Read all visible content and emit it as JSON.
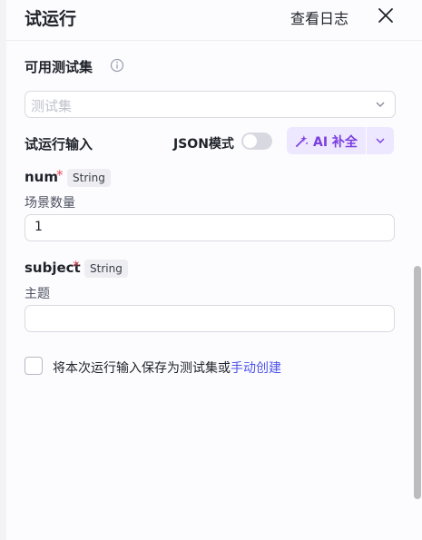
{
  "header": {
    "title": "试运行",
    "view_log": "查看日志",
    "close_icon": "close-icon"
  },
  "testset": {
    "label": "可用测试集",
    "info_icon": "info-icon",
    "placeholder": "测试集",
    "chevron_icon": "chevron-down-icon"
  },
  "run_input": {
    "label": "试运行输入",
    "json_mode_label": "JSON模式",
    "json_mode_on": false,
    "ai_button_label": "AI 补全",
    "ai_icon": "sparkle-icon"
  },
  "fields": [
    {
      "name": "num",
      "required_mark": "*",
      "type": "String",
      "description": "场景数量",
      "value": "1"
    },
    {
      "name": "subject",
      "required_mark": "*",
      "type": "String",
      "description": "主题",
      "value": ""
    }
  ],
  "save": {
    "checked": false,
    "prefix": "将本次运行输入保存为测试集或",
    "link": "手动创建"
  },
  "colors": {
    "accent": "#4d53e8",
    "ai_bg": "#ede7ff",
    "ai_text": "#7a3ee0",
    "required": "#e34d59"
  }
}
